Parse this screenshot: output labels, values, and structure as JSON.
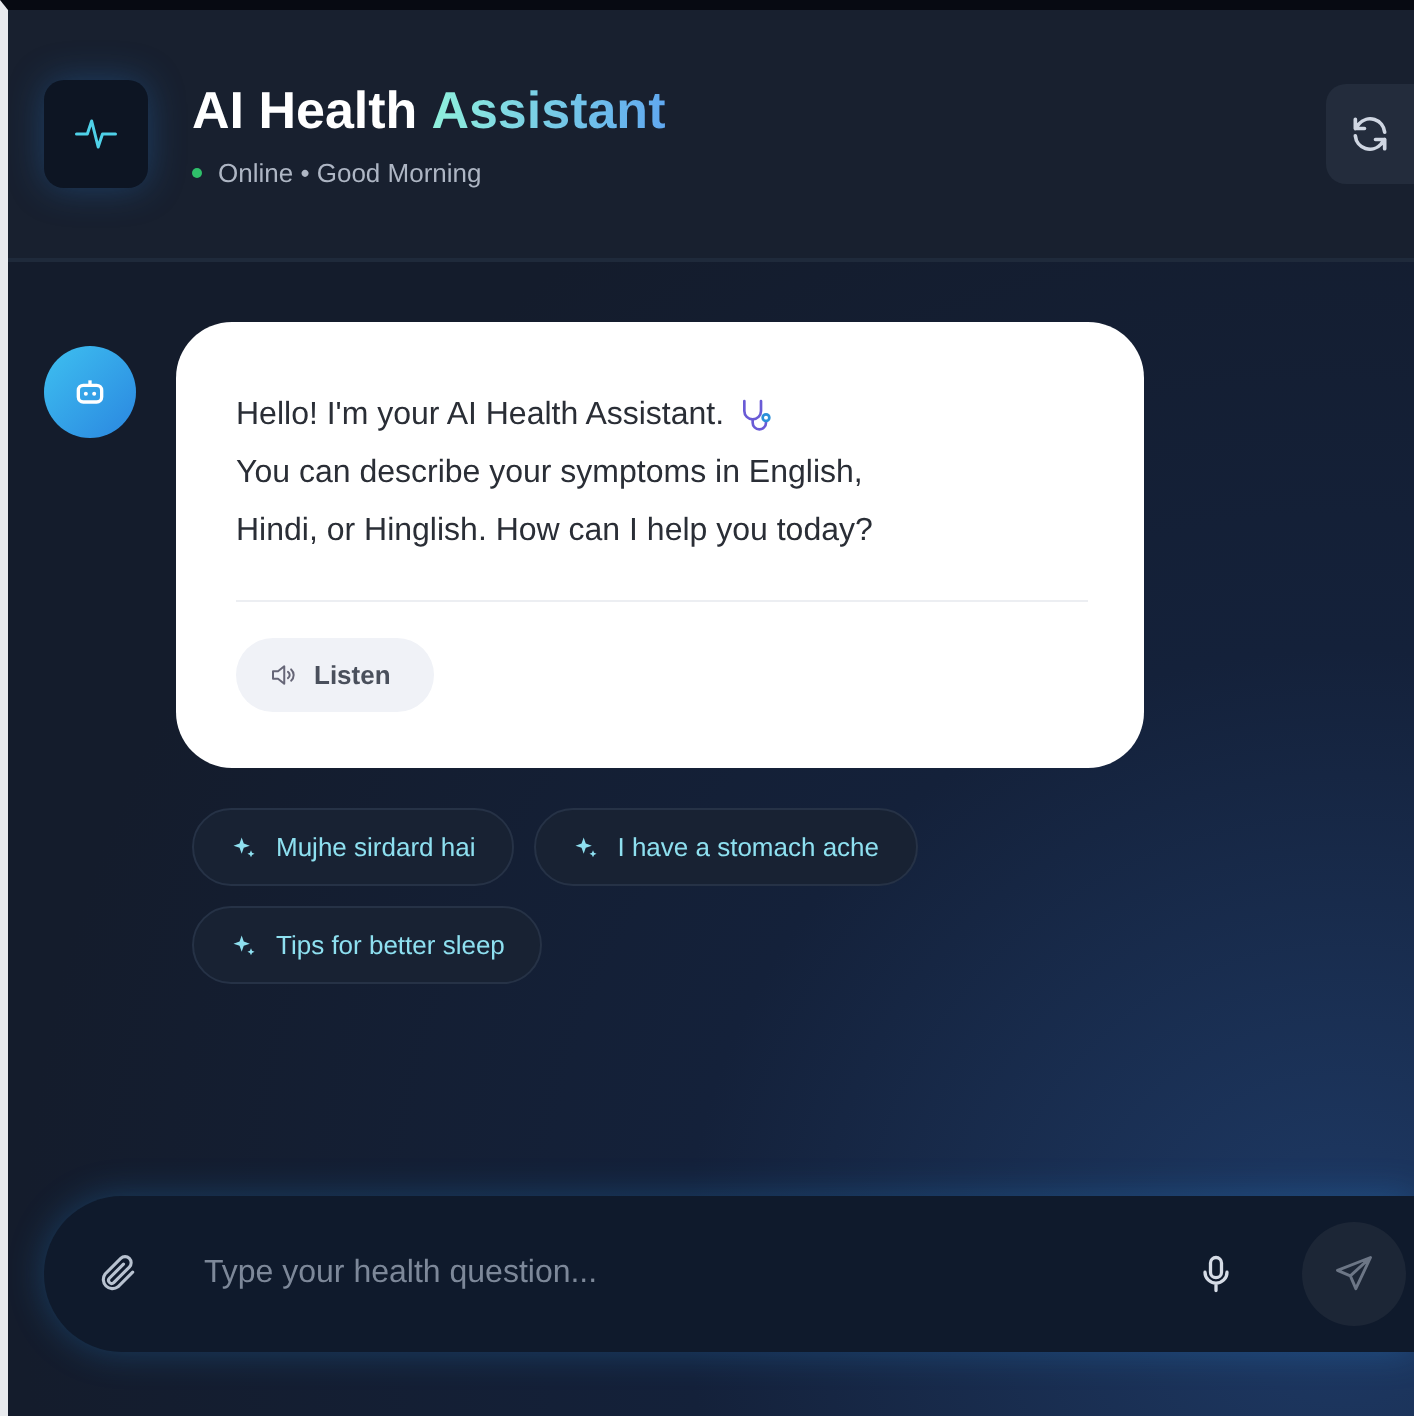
{
  "header": {
    "title_lead": "AI Health",
    "title_accent": "Assistant",
    "status": "Online • Good Morning"
  },
  "message": {
    "first_line": "Hello! I'm your AI Health Assistant.",
    "rest_lines": [
      "You can describe your symptoms in English,",
      "Hindi, or Hinglish. How can I help you today?"
    ],
    "listen_label": "Listen"
  },
  "suggestions": [
    "Mujhe sirdard hai",
    "I have a stomach ache",
    "Tips for better sleep"
  ],
  "composer": {
    "placeholder": "Type your health question..."
  }
}
